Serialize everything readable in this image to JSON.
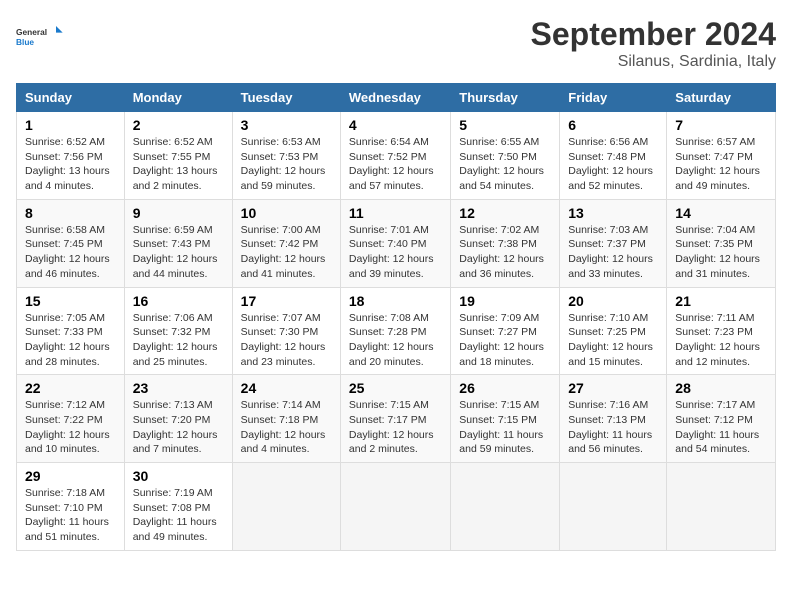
{
  "logo": {
    "text_general": "General",
    "text_blue": "Blue"
  },
  "header": {
    "month": "September 2024",
    "location": "Silanus, Sardinia, Italy"
  },
  "days_of_week": [
    "Sunday",
    "Monday",
    "Tuesday",
    "Wednesday",
    "Thursday",
    "Friday",
    "Saturday"
  ],
  "weeks": [
    [
      {
        "day": "1",
        "sunrise": "6:52 AM",
        "sunset": "7:56 PM",
        "daylight": "13 hours and 4 minutes."
      },
      {
        "day": "2",
        "sunrise": "6:52 AM",
        "sunset": "7:55 PM",
        "daylight": "13 hours and 2 minutes."
      },
      {
        "day": "3",
        "sunrise": "6:53 AM",
        "sunset": "7:53 PM",
        "daylight": "12 hours and 59 minutes."
      },
      {
        "day": "4",
        "sunrise": "6:54 AM",
        "sunset": "7:52 PM",
        "daylight": "12 hours and 57 minutes."
      },
      {
        "day": "5",
        "sunrise": "6:55 AM",
        "sunset": "7:50 PM",
        "daylight": "12 hours and 54 minutes."
      },
      {
        "day": "6",
        "sunrise": "6:56 AM",
        "sunset": "7:48 PM",
        "daylight": "12 hours and 52 minutes."
      },
      {
        "day": "7",
        "sunrise": "6:57 AM",
        "sunset": "7:47 PM",
        "daylight": "12 hours and 49 minutes."
      }
    ],
    [
      {
        "day": "8",
        "sunrise": "6:58 AM",
        "sunset": "7:45 PM",
        "daylight": "12 hours and 46 minutes."
      },
      {
        "day": "9",
        "sunrise": "6:59 AM",
        "sunset": "7:43 PM",
        "daylight": "12 hours and 44 minutes."
      },
      {
        "day": "10",
        "sunrise": "7:00 AM",
        "sunset": "7:42 PM",
        "daylight": "12 hours and 41 minutes."
      },
      {
        "day": "11",
        "sunrise": "7:01 AM",
        "sunset": "7:40 PM",
        "daylight": "12 hours and 39 minutes."
      },
      {
        "day": "12",
        "sunrise": "7:02 AM",
        "sunset": "7:38 PM",
        "daylight": "12 hours and 36 minutes."
      },
      {
        "day": "13",
        "sunrise": "7:03 AM",
        "sunset": "7:37 PM",
        "daylight": "12 hours and 33 minutes."
      },
      {
        "day": "14",
        "sunrise": "7:04 AM",
        "sunset": "7:35 PM",
        "daylight": "12 hours and 31 minutes."
      }
    ],
    [
      {
        "day": "15",
        "sunrise": "7:05 AM",
        "sunset": "7:33 PM",
        "daylight": "12 hours and 28 minutes."
      },
      {
        "day": "16",
        "sunrise": "7:06 AM",
        "sunset": "7:32 PM",
        "daylight": "12 hours and 25 minutes."
      },
      {
        "day": "17",
        "sunrise": "7:07 AM",
        "sunset": "7:30 PM",
        "daylight": "12 hours and 23 minutes."
      },
      {
        "day": "18",
        "sunrise": "7:08 AM",
        "sunset": "7:28 PM",
        "daylight": "12 hours and 20 minutes."
      },
      {
        "day": "19",
        "sunrise": "7:09 AM",
        "sunset": "7:27 PM",
        "daylight": "12 hours and 18 minutes."
      },
      {
        "day": "20",
        "sunrise": "7:10 AM",
        "sunset": "7:25 PM",
        "daylight": "12 hours and 15 minutes."
      },
      {
        "day": "21",
        "sunrise": "7:11 AM",
        "sunset": "7:23 PM",
        "daylight": "12 hours and 12 minutes."
      }
    ],
    [
      {
        "day": "22",
        "sunrise": "7:12 AM",
        "sunset": "7:22 PM",
        "daylight": "12 hours and 10 minutes."
      },
      {
        "day": "23",
        "sunrise": "7:13 AM",
        "sunset": "7:20 PM",
        "daylight": "12 hours and 7 minutes."
      },
      {
        "day": "24",
        "sunrise": "7:14 AM",
        "sunset": "7:18 PM",
        "daylight": "12 hours and 4 minutes."
      },
      {
        "day": "25",
        "sunrise": "7:15 AM",
        "sunset": "7:17 PM",
        "daylight": "12 hours and 2 minutes."
      },
      {
        "day": "26",
        "sunrise": "7:15 AM",
        "sunset": "7:15 PM",
        "daylight": "11 hours and 59 minutes."
      },
      {
        "day": "27",
        "sunrise": "7:16 AM",
        "sunset": "7:13 PM",
        "daylight": "11 hours and 56 minutes."
      },
      {
        "day": "28",
        "sunrise": "7:17 AM",
        "sunset": "7:12 PM",
        "daylight": "11 hours and 54 minutes."
      }
    ],
    [
      {
        "day": "29",
        "sunrise": "7:18 AM",
        "sunset": "7:10 PM",
        "daylight": "11 hours and 51 minutes."
      },
      {
        "day": "30",
        "sunrise": "7:19 AM",
        "sunset": "7:08 PM",
        "daylight": "11 hours and 49 minutes."
      },
      null,
      null,
      null,
      null,
      null
    ]
  ]
}
